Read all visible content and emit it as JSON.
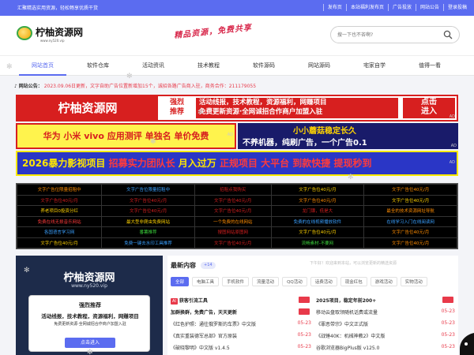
{
  "topbar": {
    "left_text": "汇聚精选实用资源，轻松畅享优质干货",
    "links": [
      "发布页",
      "本站福利发布页",
      "广告投放",
      "网站公告",
      "登录投稿"
    ]
  },
  "header": {
    "logo_title": "柠柚资源网",
    "logo_sub": "www.ny520.vip",
    "slogan": "精品资源，免费共享",
    "search_placeholder": "搜一下也不吝啊?"
  },
  "nav": [
    "网站首页",
    "软件仓库",
    "活动资讯",
    "技术教程",
    "软件源码",
    "网站源码",
    "宅家自学",
    "值得一看"
  ],
  "notice": {
    "label": "网站公告：",
    "text": "2023.09.06日更新，文字自助广告位置新增加15个，诚招各路广告商入驻，商务合作：211179055"
  },
  "banners": {
    "b1": {
      "left": "柠柚资源网",
      "mid1a": "强烈",
      "mid1b": "推荐",
      "mid2a": "活动线报，技术教程，资源福利，网赚项目",
      "mid2b": "免费更新资源·全网诚招合作商户加盟入驻",
      "righta": "点击",
      "rightb": "进入",
      "tag": "AD"
    },
    "b2": {
      "text": "华为 小米 vivo 应用测评 单独名 单价免费",
      "tag": "AD"
    },
    "b3": {
      "row1": "小小蘑菇稳定长久",
      "row2": "不养机器，纯刷广告，一个广告0.1",
      "tag": "AD"
    },
    "b4": {
      "a": "2026暴力影视项目",
      "b": " 招募实力团队长 ",
      "c": "月入过万 ",
      "d": "正规项目 大平台 到款快捷 提现秒到",
      "tag": "AD"
    }
  },
  "ad_grid": {
    "rows": [
      [
        "文字广告位限量招租中",
        "文字广告位限量招租中",
        "招租点我购买",
        "文字广告位40元/月",
        "文字广告位40元/月"
      ],
      [
        "文字广告位40元/月",
        "文字广告位40元/月",
        "文字广告位40元/月",
        "文字广告位40元/月",
        "文字广告位40元/月"
      ],
      [
        "养老项目0投资分红",
        "文字广告位40元/月",
        "文字广告位40元/月",
        "龙门镖，低是大",
        "最全的技术资源网址导航"
      ],
      [
        "免费在线无损音乐网站",
        "最大型非爬虫免费网站",
        "一个免费的在线网站",
        "免费的在线视频播放软件",
        "在线学习入门在线阅读网"
      ],
      [
        "各国语言学习网",
        "番薯推荐",
        "搜图网站原图网",
        "文字广告位40元/月",
        "文字广告位40元/月"
      ],
      [
        "文字广告位40元/月",
        "免费一键去水印工具推荐",
        "文字广告位40元/月",
        "流畅素材-不要网",
        "文字广告位40元/月"
      ]
    ],
    "colors": [
      [
        "#ff8c00",
        "#3aa0ff",
        "#d71f1f",
        "#ffd200",
        "#ff8c00"
      ],
      [
        "#d71f1f",
        "#d71f1f",
        "#d71f1f",
        "#ff8c00",
        "#ffd200"
      ],
      [
        "#ffd200",
        "#d71f1f",
        "#d71f1f",
        "#d71f1f",
        "#ff8c00"
      ],
      [
        "#ff3b3b",
        "#ffd200",
        "#ff8c00",
        "#3aa0ff",
        "#3aa0ff"
      ],
      [
        "#3aa0ff",
        "#3acf3a",
        "#d71f1f",
        "#ffd200",
        "#ff8c00"
      ],
      [
        "#ffd200",
        "#3aa0ff",
        "#d71f1f",
        "#3acf3a",
        "#ff8c00"
      ]
    ]
  },
  "left_panel": {
    "title": "柠柚资源网",
    "url": "www.ny520.vip",
    "box_title": "强烈推荐",
    "box_line1": "活动线报，技术教程，资源福利，网赚项目",
    "box_line2": "免费更新资源·全网诚招合作商户加盟入驻",
    "button": "点击进入"
  },
  "right_panel": {
    "title": "最新内容",
    "count": "+14",
    "scroll_text": "下午好！欢迎来到本站，可以浏览更新的精选资源",
    "tabs": [
      "全部",
      "电脑工具",
      "手机软件",
      "流量活动",
      "QQ活动",
      "话费活动",
      "现金红包",
      "游戏活动",
      "实物活动"
    ],
    "rows": [
      {
        "l_tag": "AI",
        "l": "获客引流工具",
        "l_badge": "赞助",
        "r": "2025项目，稳定年前200+",
        "r_badge": "赞助"
      },
      {
        "l": "加群换群，免费广告，天天更新",
        "l_badge": "赞助",
        "r": "移动云盘取领随机话费或流量",
        "r_date": "05-23"
      },
      {
        "l": "《红色护照：通往俄罗斯的车票》中文版",
        "l_date": "05-23",
        "r": "《罪恶带宗》中文正式版",
        "r_date": "05-23"
      },
      {
        "l": "《真实重装德军总部》官方原装",
        "l_date": "05-23",
        "r": "《战锤40K：机械神教2》中文版",
        "r_date": "05-23"
      },
      {
        "l": "《破晓黎明》中文版 v1.4.5",
        "l_date": "05-23",
        "r": "谷歌浏览器BigPlus版 v125.0",
        "r_date": "05-23"
      }
    ]
  }
}
